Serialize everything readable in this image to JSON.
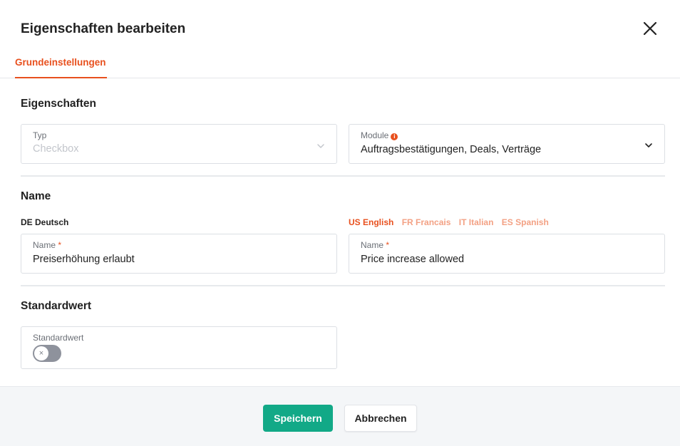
{
  "dialog": {
    "title": "Eigenschaften bearbeiten"
  },
  "tabs": [
    {
      "label": "Grundeinstellungen",
      "active": true
    }
  ],
  "properties_section": {
    "title": "Eigenschaften",
    "type_field": {
      "label": "Typ",
      "value": "Checkbox",
      "disabled": true
    },
    "module_field": {
      "label": "Module",
      "info_icon": "info-icon",
      "value": "Auftragsbestätigungen, Deals, Verträge"
    }
  },
  "name_section": {
    "title": "Name",
    "default_language": "DE Deutsch",
    "languages": [
      {
        "label": "US English",
        "active": true
      },
      {
        "label": "FR Francais",
        "active": false
      },
      {
        "label": "IT Italian",
        "active": false
      },
      {
        "label": "ES Spanish",
        "active": false
      }
    ],
    "name_de": {
      "label": "Name",
      "required_mark": "*",
      "value": "Preiserhöhung erlaubt"
    },
    "name_translated": {
      "label": "Name",
      "required_mark": "*",
      "value": "Price increase allowed"
    }
  },
  "default_section": {
    "title": "Standardwert",
    "field_label": "Standardwert",
    "toggle_on": false,
    "toggle_symbol": "×"
  },
  "footer": {
    "save_label": "Speichern",
    "cancel_label": "Abbrechen"
  },
  "colors": {
    "accent": "#e8501e",
    "primary_button": "#12a987",
    "toggle_off": "#8e929c"
  }
}
